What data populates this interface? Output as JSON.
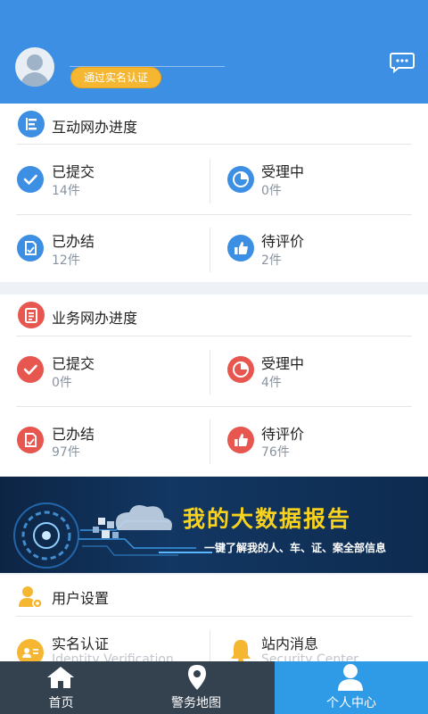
{
  "header": {
    "verify_badge": "通过实名认证",
    "message_icon": "chat-bubble-icon"
  },
  "section1": {
    "title": "互动网办进度",
    "items": [
      {
        "label": "已提交",
        "count": "14件",
        "icon": "check-circle-icon"
      },
      {
        "label": "受理中",
        "count": "0件",
        "icon": "pie-progress-icon"
      },
      {
        "label": "已办结",
        "count": "12件",
        "icon": "document-done-icon"
      },
      {
        "label": "待评价",
        "count": "2件",
        "icon": "thumbs-up-icon"
      }
    ]
  },
  "section2": {
    "title": "业务网办进度",
    "items": [
      {
        "label": "已提交",
        "count": "0件",
        "icon": "check-circle-icon"
      },
      {
        "label": "受理中",
        "count": "4件",
        "icon": "pie-progress-icon"
      },
      {
        "label": "已办结",
        "count": "97件",
        "icon": "document-done-icon"
      },
      {
        "label": "待评价",
        "count": "76件",
        "icon": "thumbs-up-icon"
      }
    ]
  },
  "banner": {
    "title": "我的大数据报告",
    "subtitle": "一键了解我的人、车、证、案全部信息"
  },
  "settings": {
    "title": "用户设置",
    "items": [
      {
        "label": "实名认证",
        "sub": "Identity Verification"
      },
      {
        "label": "站内消息",
        "sub": "Security Center"
      }
    ]
  },
  "nav": {
    "items": [
      {
        "label": "首页"
      },
      {
        "label": "警务地图"
      },
      {
        "label": "个人中心"
      }
    ]
  },
  "colors": {
    "header": "#3d8fe3",
    "accent_red": "#e8574f",
    "badge": "#f5b731",
    "nav_bg": "#34414f",
    "nav_active": "#2f9ae6"
  }
}
